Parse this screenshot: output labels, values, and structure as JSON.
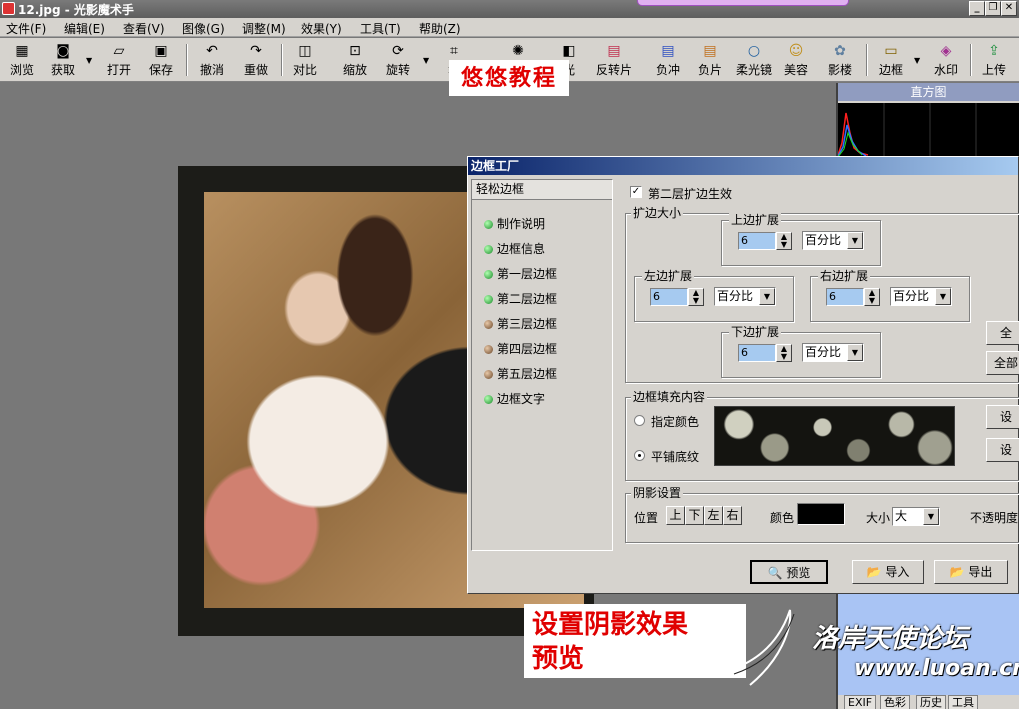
{
  "window": {
    "title": "12.jpg - 光影魔术手",
    "minimize": "_",
    "restore": "❐",
    "close": "✕"
  },
  "menu": [
    "文件(F)",
    "编辑(E)",
    "查看(V)",
    "图像(G)",
    "调整(M)",
    "效果(Y)",
    "工具(T)",
    "帮助(Z)"
  ],
  "toolbar": [
    {
      "label": "浏览",
      "icon": "browse-icon",
      "glyph": "▦"
    },
    {
      "label": "获取",
      "icon": "camera-icon",
      "glyph": "◙"
    },
    {
      "label": "打开",
      "icon": "folder-icon",
      "glyph": "▱"
    },
    {
      "label": "保存",
      "icon": "save-icon",
      "glyph": "▣"
    },
    {
      "label": "撤消",
      "icon": "undo-icon",
      "glyph": "↶"
    },
    {
      "label": "重做",
      "icon": "redo-icon",
      "glyph": "↷"
    },
    {
      "label": "对比",
      "icon": "compare-icon",
      "glyph": "◫"
    },
    {
      "label": "缩放",
      "icon": "resize-icon",
      "glyph": "⊡"
    },
    {
      "label": "旋转",
      "icon": "rotate-icon",
      "glyph": "⟳"
    },
    {
      "label": "裁",
      "icon": "crop-icon",
      "glyph": "⌗"
    },
    {
      "label": "曝",
      "icon": "exposure-icon",
      "glyph": "✺"
    },
    {
      "label": "光",
      "icon": "backlight-icon",
      "glyph": "◧"
    },
    {
      "label": "反转片",
      "icon": "reversal-film-icon",
      "glyph": "▤"
    },
    {
      "label": "负冲",
      "icon": "cross-process-icon",
      "glyph": "▤"
    },
    {
      "label": "负片",
      "icon": "negative-icon",
      "glyph": "▤"
    },
    {
      "label": "柔光镜",
      "icon": "soft-light-icon",
      "glyph": "○"
    },
    {
      "label": "美容",
      "icon": "beauty-icon",
      "glyph": "☺"
    },
    {
      "label": "影楼",
      "icon": "studio-icon",
      "glyph": "✿"
    },
    {
      "label": "边框",
      "icon": "frame-icon",
      "glyph": "▭"
    },
    {
      "label": "水印",
      "icon": "watermark-icon",
      "glyph": "◈"
    },
    {
      "label": "上传",
      "icon": "upload-icon",
      "glyph": "⇪"
    }
  ],
  "histogram": {
    "title": "直方图"
  },
  "right_panel": {
    "tabs": [
      "EXIF",
      "色彩",
      "历史",
      "工具"
    ]
  },
  "overlays": {
    "top_label": "悠悠教程",
    "bottom_label_line1": "设置阴影效果",
    "bottom_label_line2": "预览",
    "forum_name": "洛岸天使论坛",
    "forum_url": "www.luoan.cn"
  },
  "dialog": {
    "title": "边框工厂",
    "left_panel_title": "轻松边框",
    "nav_items": [
      {
        "label": "制作说明",
        "dot": "green"
      },
      {
        "label": "边框信息",
        "dot": "green"
      },
      {
        "label": "第一层边框",
        "dot": "green"
      },
      {
        "label": "第二层边框",
        "dot": "green"
      },
      {
        "label": "第三层边框",
        "dot": "brown"
      },
      {
        "label": "第四层边框",
        "dot": "brown"
      },
      {
        "label": "第五层边框",
        "dot": "brown"
      },
      {
        "label": "边框文字",
        "dot": "green"
      }
    ],
    "enable_checkbox": {
      "label": "第二层扩边生效",
      "checked": true,
      "mark": "✓"
    },
    "expand_group": {
      "title": "扩边大小",
      "top": {
        "label": "上边扩展",
        "value": "6",
        "unit": "百分比"
      },
      "left": {
        "label": "左边扩展",
        "value": "6",
        "unit": "百分比"
      },
      "right": {
        "label": "右边扩展",
        "value": "6",
        "unit": "百分比"
      },
      "bottom": {
        "label": "下边扩展",
        "value": "6",
        "unit": "百分比"
      },
      "btn1": "全",
      "btn2": "全部"
    },
    "fill_group": {
      "title": "边框填充内容",
      "option_color": "指定颜色",
      "option_tile": "平铺底纹",
      "selected": "平铺底纹",
      "btn1": "设",
      "btn2": "设"
    },
    "shadow_group": {
      "title": "阴影设置",
      "position_label": "位置",
      "positions": [
        "上",
        "下",
        "左",
        "右"
      ],
      "color_label": "颜色",
      "color_value": "#000000",
      "size_label": "大小",
      "size_value": "大",
      "opacity_label": "不透明度"
    },
    "buttons": {
      "preview": "预览",
      "import": "导入",
      "export": "导出"
    }
  }
}
